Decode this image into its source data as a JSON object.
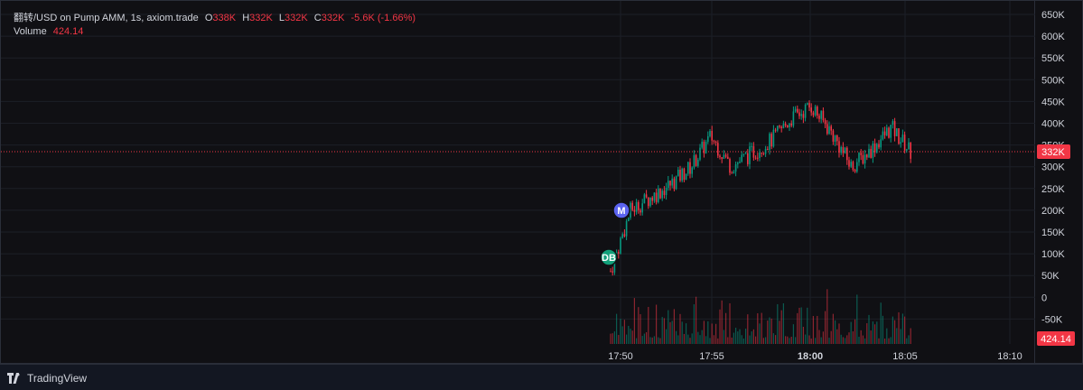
{
  "legend": {
    "symbol": "翻转/USD on Pump AMM, 1s, axiom.trade",
    "o_label": "O",
    "o_value": "338K",
    "h_label": "H",
    "h_value": "332K",
    "l_label": "L",
    "l_value": "332K",
    "c_label": "C",
    "c_value": "332K",
    "change": "-5.6K (-1.66%)",
    "volume_label": "Volume",
    "volume_value": "424.14"
  },
  "price_axis": {
    "ticks": [
      "650K",
      "600K",
      "550K",
      "500K",
      "450K",
      "400K",
      "350K",
      "300K",
      "250K",
      "200K",
      "150K",
      "100K",
      "50K",
      "0",
      "-50K"
    ],
    "current_price_badge": "332K",
    "volume_badge": "424.14"
  },
  "time_axis": {
    "ticks": [
      {
        "label": "17:50",
        "bold": false
      },
      {
        "label": "17:55",
        "bold": false
      },
      {
        "label": "18:00",
        "bold": true
      },
      {
        "label": "18:05",
        "bold": false
      },
      {
        "label": "18:10",
        "bold": false
      }
    ]
  },
  "markers": [
    {
      "label": "M",
      "color": "#5b63f0"
    },
    {
      "label": "DB",
      "color": "#12a07a"
    }
  ],
  "footer": {
    "brand": "TradingView"
  },
  "colors": {
    "up": "#089981",
    "down": "#f23645",
    "background": "#101014"
  },
  "chart_data": {
    "type": "line",
    "series": [
      {
        "x": [
          "17:50",
          "17:51",
          "17:52",
          "17:53",
          "17:54",
          "17:55",
          "17:56",
          "17:57",
          "17:58",
          "17:59",
          "18:00",
          "18:01",
          "18:02",
          "18:03",
          "18:04",
          "18:05"
        ],
        "values": [
          60000,
          200000,
          230000,
          260000,
          300000,
          370000,
          300000,
          330000,
          360000,
          410000,
          440000,
          380000,
          300000,
          340000,
          390000,
          332000
        ]
      }
    ],
    "ylim": [
      -50000,
      650000
    ]
  }
}
